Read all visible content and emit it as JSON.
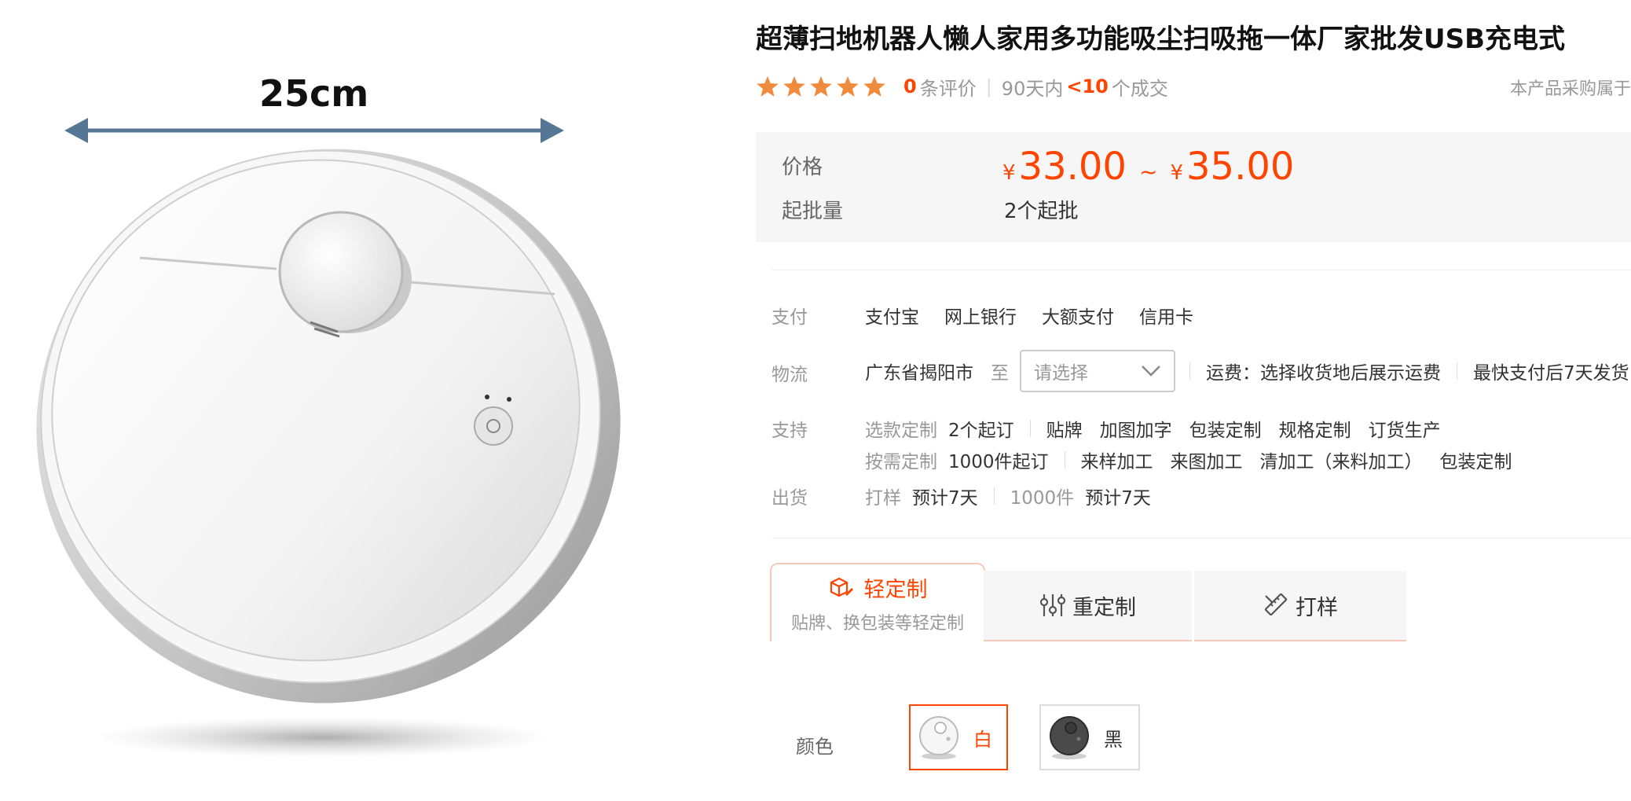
{
  "product_image": {
    "dimension_label": "25cm"
  },
  "product": {
    "title": "超薄扫地机器人懒人家用多功能吸尘扫吸拖一体厂家批发USB充电式"
  },
  "rating": {
    "stars": 5,
    "review_count": "0",
    "review_suffix": "条评价",
    "deals_prefix": "90天内",
    "deals_count": "<10",
    "deals_suffix": "个成交"
  },
  "notice": "本产品采购属于",
  "price_box": {
    "price_label": "价格",
    "currency": "¥",
    "price_min": "33.00",
    "range_sep": "~",
    "price_max": "35.00",
    "moq_label": "起批量",
    "moq_value": "2个起批"
  },
  "payment": {
    "label": "支付",
    "methods": [
      "支付宝",
      "网上银行",
      "大额支付",
      "信用卡"
    ]
  },
  "logistics": {
    "label": "物流",
    "origin": "广东省揭阳市",
    "to": "至",
    "select_placeholder": "请选择",
    "freight": "运费：选择收货地后展示运费",
    "delivery": "最快支付后7天发货"
  },
  "support": {
    "label": "支持",
    "row1_type": "选款定制",
    "row1_moq": "2个起订",
    "row1_items": [
      "贴牌",
      "加图加字",
      "包装定制",
      "规格定制",
      "订货生产"
    ],
    "row2_type": "按需定制",
    "row2_moq": "1000件起订",
    "row2_items": [
      "来样加工",
      "来图加工",
      "清加工（来料加工）",
      "包装定制"
    ]
  },
  "shipping": {
    "label": "出货",
    "sample_label": "打样",
    "sample_time": "预计7天",
    "bulk_label": "1000件",
    "bulk_time": "预计7天"
  },
  "tabs": {
    "light": "轻定制",
    "light_sub": "贴牌、换包装等轻定制",
    "heavy": "重定制",
    "sample": "打样"
  },
  "colors": {
    "label": "颜色",
    "options": [
      "白",
      "黑"
    ]
  },
  "theme": {
    "accent": "#ff4400",
    "star": "#f08a3c"
  }
}
